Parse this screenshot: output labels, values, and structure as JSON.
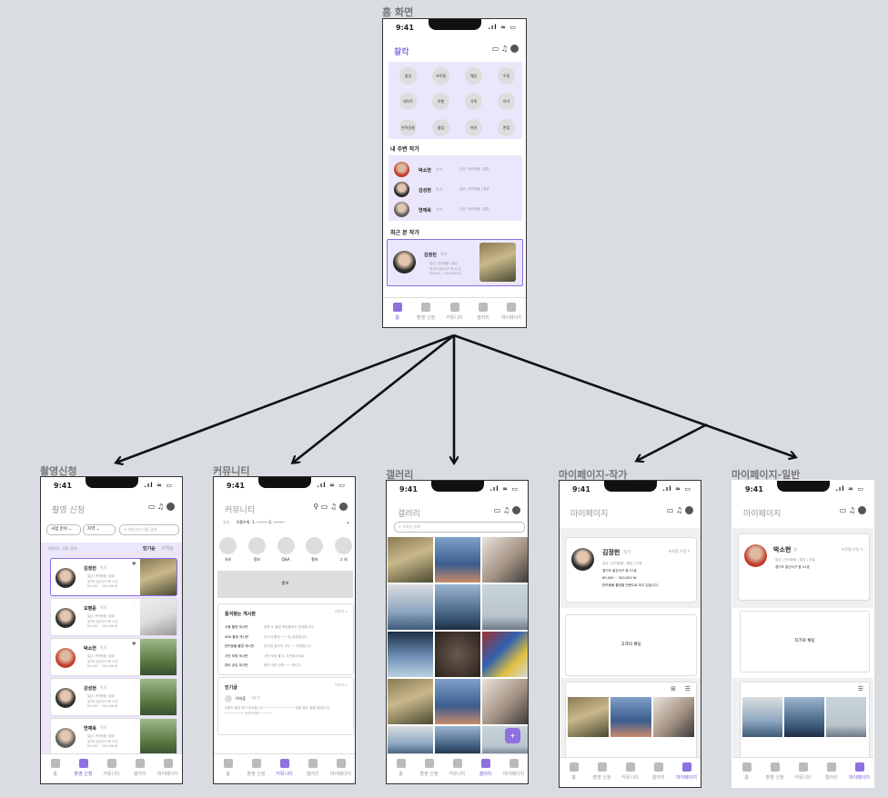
{
  "screens": {
    "home": {
      "label": "홈 화면",
      "time": "9:41",
      "logo": "찰칵",
      "categories": [
        "졸업",
        "프로필",
        "웨딩",
        "우정",
        "데이트",
        "여행",
        "가족",
        "아기",
        "반려동물",
        "졸업",
        "여권",
        "면접"
      ],
      "nearby_title": "내 주변 작가",
      "nearby": [
        {
          "name": "박소연",
          "role": "작가",
          "tags": "일상 | 반려동물 | 졸업"
        },
        {
          "name": "김성현",
          "role": "작가",
          "tags": "일상 | 반려동물 | 졸업"
        },
        {
          "name": "연재욱",
          "role": "작가",
          "tags": "일상 | 반려동물 | 졸업"
        }
      ],
      "recent_title": "최근 본 작가",
      "recent": {
        "name": "김정헌",
        "role": "작가",
        "tags": "일상 | 반려동물 | 졸업",
        "address": "경기도 일산서구 중 21호",
        "price": "80,000 ~ 300,000 W"
      },
      "tabs": [
        "홈",
        "촬영 신청",
        "커뮤니티",
        "갤러리",
        "마이페이지"
      ]
    },
    "booking": {
      "label": "촬영신청",
      "time": "9:41",
      "title": "촬영 신청",
      "filter_category": "사업 분야",
      "filter_region": "지역",
      "search_placeholder": "카테고리 이름 검색",
      "sort_label": "6명자도 사용 검색",
      "sort_options": [
        "인기순",
        "가격순"
      ],
      "photographers": [
        {
          "name": "김정헌",
          "role": "작가",
          "tags": "일상 | 반려동물 | 졸업",
          "address": "경기도 일산서구 중 21호",
          "price": "80,000 ~ 300,000 W"
        },
        {
          "name": "오평준",
          "role": "작가",
          "tags": "일상 | 반려동물 | 졸업",
          "address": "경기도 일산서구 중 21호",
          "price": "80,000 ~ 300,000 W"
        },
        {
          "name": "박소연",
          "role": "작가",
          "tags": "일상 | 반려동물 | 졸업",
          "address": "경기도 일산서구 중 21호",
          "price": "80,000 ~ 300,000 W"
        },
        {
          "name": "강성현",
          "role": "작가",
          "tags": "일상 | 반려동물 | 졸업",
          "address": "경기도 일산서구 중 21호",
          "price": "80,000 ~ 300,000 W"
        },
        {
          "name": "연재욱",
          "role": "작가",
          "tags": "일상 | 반려동물 | 졸업",
          "address": "경기도 일산서구 중 21호",
          "price": "80,000 ~ 300,000 W"
        }
      ]
    },
    "community": {
      "label": "커뮤니티",
      "time": "9:41",
      "title": "커뮤니티",
      "notice_label": "공지",
      "notice_text": "이용수칙: 1. ───── 2. ─────",
      "boards": [
        "자유",
        "정보",
        "Q&A",
        "홍보",
        "그 외"
      ],
      "banner": "홍보",
      "fav_title": "즐겨찾는 게시판",
      "more": "더보기 >",
      "fav_boards": [
        {
          "name": "사용 촬영 게시판",
          "preview": "공원 도 촬영 포트폴리오 공개합니다"
        },
        {
          "name": "SNS 촬영 게시판",
          "preview": "인스타 촬영 ─── 팁 공유합니다"
        },
        {
          "name": "반려동물 촬영 게시판",
          "preview": "우리집 강아지 사진 ── 자랑합니다"
        },
        {
          "name": "사진 보정 게시판",
          "preview": "사진 보정 툴 도 추천해주세요"
        },
        {
          "name": "장비 공유 게시판",
          "preview": "렌즈 대여 신청 ─── 합니다"
        }
      ],
      "hot_title": "인기글",
      "hot_author": "이지훈",
      "hot_time": "1분 전",
      "hot_body": "강원도 촬영 후기 공유합니다 ──────────────── 정말 좋은 경험이었습니다 ────────── 추천드려요 ──────"
    },
    "gallery": {
      "label": "갤러리",
      "time": "9:41",
      "title": "갤러리",
      "search_placeholder": "지역이 검색"
    },
    "mypage_artist": {
      "label": "마이페이지-작가",
      "time": "9:41",
      "title": "마이페이지",
      "name": "김정헌",
      "role": "작가",
      "edit": "프로필 수정",
      "tags": "일상 | 반려동물 | 졸업 | 우정",
      "address": "경기도 일산서구 중 21호",
      "price": "80,000 ~ 300,000 W",
      "intro": "반려동물 촬영을 전문으로 하고 있습니다.",
      "section": "고객의 채팅"
    },
    "mypage_user": {
      "label": "마이페이지-일반",
      "time": "9:41",
      "title": "마이페이지",
      "name": "박소현",
      "role": "님",
      "edit": "프로필 수정",
      "tags": "일상 | 반려동물 | 졸업 | 우정",
      "address": "경기도 일산서구 중 21호",
      "section": "작가와 채팅"
    }
  }
}
